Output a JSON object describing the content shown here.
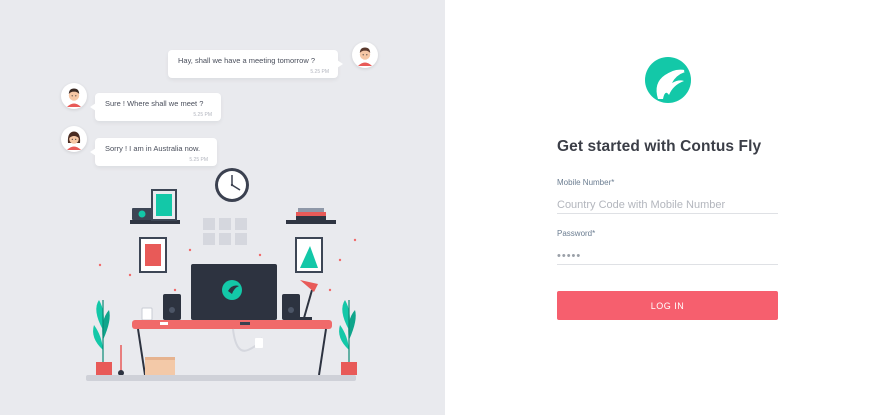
{
  "chat": {
    "messages": [
      {
        "text": "Hay, shall we have a meeting tomorrow ?",
        "time": "5.25 PM"
      },
      {
        "text": "Sure ! Where shall we meet ?",
        "time": "5.25 PM"
      },
      {
        "text": "Sorry ! I am in Australia now.",
        "time": "5.25 PM"
      }
    ]
  },
  "login": {
    "heading": "Get started with Contus Fly",
    "mobile_label": "Mobile Number*",
    "mobile_placeholder": "Country Code with Mobile Number",
    "password_label": "Password*",
    "password_placeholder": "•••••",
    "button_label": "LOG IN"
  },
  "colors": {
    "brand": "#13c8a8",
    "button": "#f65f6e",
    "panel_bg": "#e9eaee"
  },
  "icons": {
    "logo": "contus-fly-logo-icon",
    "clock": "wall-clock-icon"
  }
}
